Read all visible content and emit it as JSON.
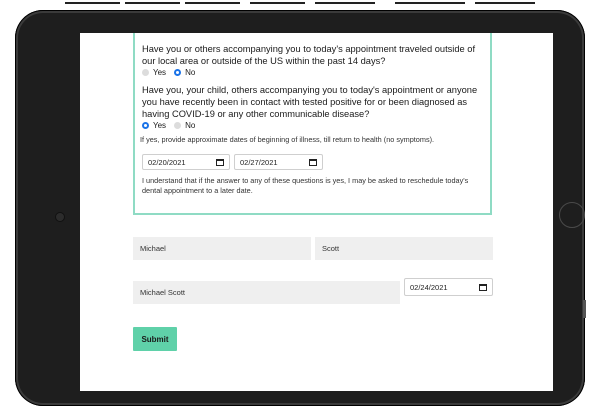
{
  "form": {
    "q1": {
      "text": "Have you or others accompanying you to today's appointment traveled outside of our local area or outside of the US within the past 14 days?",
      "options": [
        "Yes",
        "No"
      ],
      "selected": "No"
    },
    "q2": {
      "text": "Have you, your child, others accompanying you to today's appointment or anyone you have recently been in contact with tested positive for or been diagnosed as having COVID-19 or any other communicable disease?",
      "options": [
        "Yes",
        "No"
      ],
      "selected": "Yes"
    },
    "illness_dates_label": "If yes, provide approximate dates of beginning of illness, till return to health (no symptoms).",
    "illness_start": "02/20/2021",
    "illness_end": "02/27/2021",
    "notice": "I understand that if the answer to any of these questions is yes, I may be asked to reschedule today's dental appointment to a later date.",
    "first_name": "Michael",
    "last_name": "Scott",
    "signature": "Michael Scott",
    "signature_date": "02/24/2021",
    "submit_label": "Submit"
  },
  "colors": {
    "accent": "#5fd1a9",
    "card_border": "#8fdbc4",
    "radio_selected": "#1a73e8",
    "field_bg": "#efefef",
    "device": "#1e1e1e"
  },
  "icons": [
    "calendar-icon",
    "camera-icon",
    "home-button-icon"
  ]
}
